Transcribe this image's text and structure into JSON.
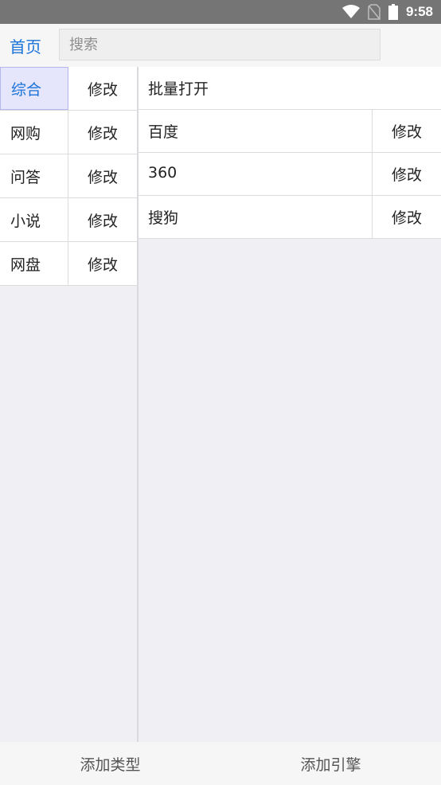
{
  "status_bar": {
    "time": "9:58",
    "icons": [
      "wifi-icon",
      "no-sim-icon",
      "battery-icon"
    ]
  },
  "header": {
    "home_label": "首页",
    "search_placeholder": "搜索"
  },
  "categories": [
    {
      "name": "综合",
      "edit": "修改",
      "active": true
    },
    {
      "name": "网购",
      "edit": "修改",
      "active": false
    },
    {
      "name": "问答",
      "edit": "修改",
      "active": false
    },
    {
      "name": "小说",
      "edit": "修改",
      "active": false
    },
    {
      "name": "网盘",
      "edit": "修改",
      "active": false
    }
  ],
  "engines_panel": {
    "batch_open_label": "批量打开",
    "engines": [
      {
        "name": "百度",
        "edit": "修改"
      },
      {
        "name": "360",
        "edit": "修改"
      },
      {
        "name": "搜狗",
        "edit": "修改"
      }
    ]
  },
  "footer": {
    "add_type_label": "添加类型",
    "add_engine_label": "添加引擎"
  },
  "colors": {
    "accent": "#1a73d9",
    "active_bg": "#e5e5fb",
    "status_bar_bg": "#757575"
  }
}
